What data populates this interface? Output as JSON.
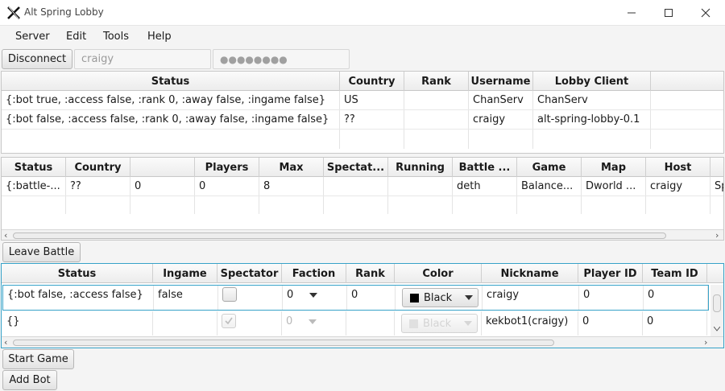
{
  "window": {
    "title": "Alt Spring Lobby",
    "icon": "x-logo-icon"
  },
  "menu": [
    "Server",
    "Edit",
    "Tools",
    "Help"
  ],
  "toolbar": {
    "disconnect_label": "Disconnect",
    "username_value": "craigy",
    "password_mask": "●●●●●●●●"
  },
  "users_table": {
    "columns": [
      "Status",
      "Country",
      "Rank",
      "Username",
      "Lobby Client"
    ],
    "rows": [
      [
        "{:bot true, :access false, :rank 0, :away false, :ingame false}",
        "US",
        "",
        "ChanServ",
        "ChanServ"
      ],
      [
        "{:bot false, :access false, :rank 0, :away false, :ingame false}",
        "??",
        "",
        "craigy",
        "alt-spring-lobby-0.1"
      ]
    ]
  },
  "battles_table": {
    "columns": [
      "Status",
      "Country",
      "",
      "Players",
      "Max",
      "Spectat...",
      "Running",
      "Battle ...",
      "Game",
      "Map",
      "Host"
    ],
    "rows": [
      [
        "{:battle-...",
        "??",
        "0",
        "0",
        "8",
        "",
        "",
        "deth",
        "Balance...",
        "Dworld ...",
        "craigy",
        "Sp"
      ]
    ]
  },
  "leave_battle_label": "Leave Battle",
  "players_table": {
    "columns": [
      "Status",
      "Ingame",
      "Spectator",
      "Faction",
      "Rank",
      "Color",
      "Nickname",
      "Player ID",
      "Team ID"
    ],
    "rows": [
      {
        "status": "{:bot false, :access false}",
        "ingame": "false",
        "spectator": false,
        "faction": "0",
        "rank": "0",
        "color_label": "Black",
        "color": "#000000",
        "nickname": "craigy",
        "player_id": "0",
        "team_id": "0",
        "disabled": false
      },
      {
        "status": "{}",
        "ingame": "",
        "spectator": true,
        "faction": "0",
        "rank": "",
        "color_label": "Black",
        "color": "#cccccc",
        "nickname": "kekbot1(craigy)",
        "player_id": "0",
        "team_id": "0",
        "disabled": true
      }
    ]
  },
  "start_game_label": "Start Game",
  "add_bot_label": "Add Bot",
  "colors": {
    "accent_focus": "#36a2c8",
    "selected_row_border": "#36a2c8"
  }
}
